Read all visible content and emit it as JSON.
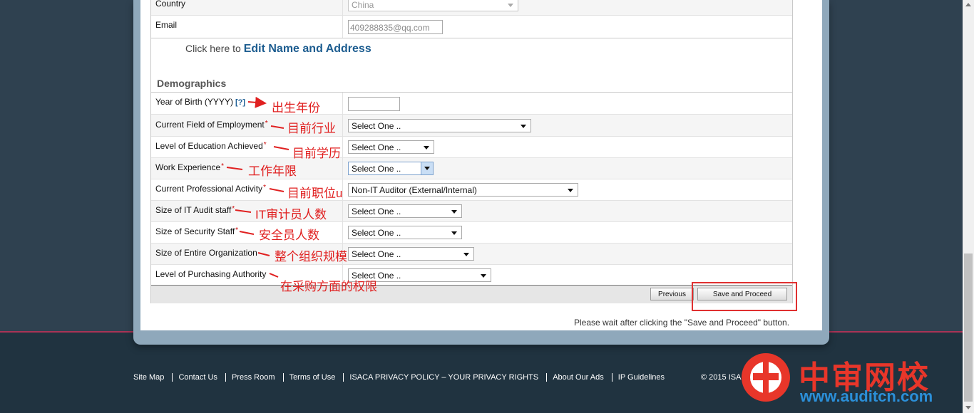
{
  "contact": {
    "country_label": "Country",
    "country_value": "China",
    "email_label": "Email",
    "email_value": "409288835@qq.com",
    "edit_prefix": "Click here to",
    "edit_link": "Edit Name and Address"
  },
  "demographics": {
    "heading": "Demographics",
    "help_marker": "[?]",
    "required_marker": "*",
    "fields": [
      {
        "label": "Year of Birth (YYYY)",
        "value": "",
        "annotation": "出生年份"
      },
      {
        "label": "Current Field of Employment",
        "value": "Select One ..",
        "annotation": "目前行业"
      },
      {
        "label": "Level of Education Achieved",
        "value": "Select One ..",
        "annotation": "目前学历"
      },
      {
        "label": "Work Experience",
        "value": "Select One ..",
        "annotation": "工作年限"
      },
      {
        "label": "Current Professional Activity",
        "value": "Non-IT Auditor (External/Internal)",
        "annotation": "目前职位u"
      },
      {
        "label": "Size of IT Audit staff",
        "value": "Select One ..",
        "annotation": "IT审计员人数"
      },
      {
        "label": "Size of Security Staff",
        "value": "Select One ..",
        "annotation": "安全员人数"
      },
      {
        "label": "Size of Entire Organization",
        "value": "Select One ..",
        "annotation": "整个组织规模"
      },
      {
        "label": "Level of Purchasing Authority",
        "value": "Select One ..",
        "annotation": "在采购方面的权限"
      }
    ]
  },
  "actions": {
    "previous": "Previous",
    "save": "Save and Proceed",
    "note": "Please wait after clicking the \"Save and Proceed\" button."
  },
  "footer": {
    "links": [
      "Site Map",
      "Contact Us",
      "Press Room",
      "Terms of Use",
      "ISACA PRIVACY POLICY – YOUR PRIVACY RIGHTS",
      "About Our Ads",
      "IP Guidelines"
    ],
    "copyright": "© 2015 ISA"
  },
  "watermark": {
    "chinese": "中审网校",
    "url": "www.auditcn.com"
  },
  "colors": {
    "accent_link": "#1d5d90",
    "annotation_red": "#e02020",
    "footer_bg": "#203340"
  }
}
